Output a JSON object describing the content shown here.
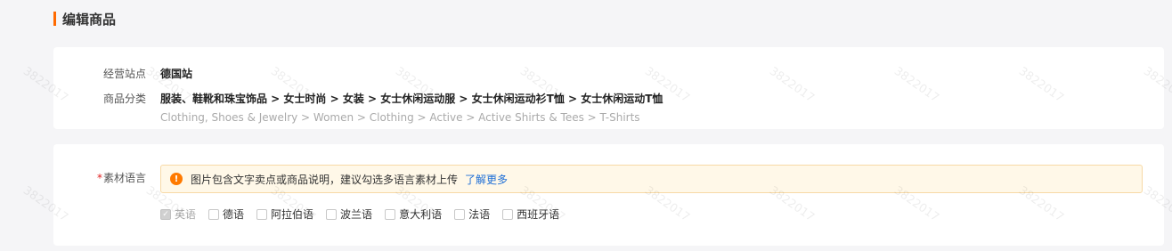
{
  "page": {
    "title": "编辑商品"
  },
  "site": {
    "label": "经营站点",
    "value": "德国站"
  },
  "category": {
    "label": "商品分类",
    "path_cn": "服装、鞋靴和珠宝饰品 > 女士时尚 > 女装 > 女士休闲运动服 > 女士休闲运动衫T恤 > 女士休闲运动T恤",
    "path_en": "Clothing, Shoes & Jewelry > Women > Clothing > Active > Active Shirts & Tees > T-Shirts"
  },
  "material_language": {
    "required_mark": "*",
    "label": "素材语言",
    "alert_text": "图片包含文字卖点或商品说明，建议勾选多语言素材上传",
    "alert_link": "了解更多",
    "options": [
      {
        "label": "英语",
        "checked": true,
        "disabled": true
      },
      {
        "label": "德语",
        "checked": false
      },
      {
        "label": "阿拉伯语",
        "checked": false
      },
      {
        "label": "波兰语",
        "checked": false
      },
      {
        "label": "意大利语",
        "checked": false
      },
      {
        "label": "法语",
        "checked": false
      },
      {
        "label": "西班牙语",
        "checked": false
      }
    ]
  },
  "watermark": {
    "text": "3822017"
  },
  "colors": {
    "accent": "#ff6a00",
    "link": "#1f6fd6",
    "alert_bg": "#fff8e8"
  }
}
